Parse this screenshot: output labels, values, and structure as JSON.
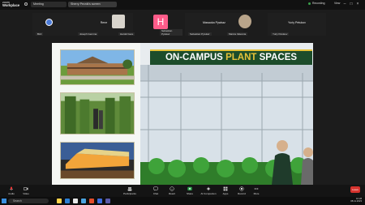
{
  "window": {
    "app_line1": "zoom",
    "app_line2": "Workplace",
    "tabs": [
      "Meeting",
      "Sherry Pecnik's screen"
    ],
    "recording_label": "Recording",
    "view_label": "View"
  },
  "participants": [
    {
      "name": "",
      "tag": "Bird",
      "kind": "blue-dot"
    },
    {
      "name": "Rene",
      "tag": "Joseph Gemma",
      "kind": "empty"
    },
    {
      "name": "",
      "tag": "Harold Gere",
      "kind": "man"
    },
    {
      "name": "",
      "tag": "Sebastian Pywkaz",
      "kind": "H"
    },
    {
      "name": "Masaoka Pywkaz",
      "tag": "Sebastian Pywkaz",
      "kind": "empty"
    },
    {
      "name": "",
      "tag": "Marcia Valencia",
      "kind": "woman"
    },
    {
      "name": "Yuriy Petukov",
      "tag": "Yuriy Petukov",
      "kind": "empty"
    }
  ],
  "slide": {
    "title_part1": "ON-CAMPUS ",
    "title_accent": "PLANT",
    "title_part2": " SPACES"
  },
  "controls": {
    "audio": "Audio",
    "video": "Video",
    "participants": "Participants",
    "chat": "Chat",
    "react": "React",
    "share": "Share",
    "ai_companion": "AI Companion",
    "apps": "Apps",
    "record": "Record",
    "more": "More",
    "leave": "Leave"
  },
  "taskbar": {
    "search": "Search",
    "time": "16:28",
    "date": "08.11.2023"
  }
}
